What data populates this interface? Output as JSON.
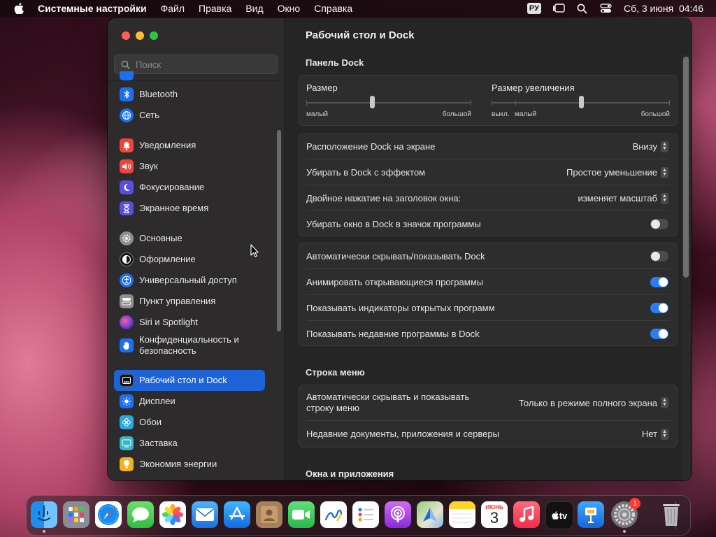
{
  "menubar": {
    "app_name": "Системные настройки",
    "items": [
      "Файл",
      "Правка",
      "Вид",
      "Окно",
      "Справка"
    ],
    "input_source": "РУ",
    "datetime": "Сб, 3 июня  04:46"
  },
  "sidebar": {
    "search_placeholder": "Поиск",
    "items": [
      {
        "label": "Bluetooth",
        "icon": "bluetooth-icon",
        "color": "#1d6ff2"
      },
      {
        "label": "Сеть",
        "icon": "globe-icon",
        "color": "#1d6ff2"
      },
      {
        "label": "Уведомления",
        "icon": "bell-icon",
        "color": "#f0443a"
      },
      {
        "label": "Звук",
        "icon": "speaker-icon",
        "color": "#f0443a"
      },
      {
        "label": "Фокусирование",
        "icon": "moon-icon",
        "color": "#5a4ee0"
      },
      {
        "label": "Экранное время",
        "icon": "hourglass-icon",
        "color": "#5a4ee0"
      },
      {
        "label": "Основные",
        "icon": "gear-icon",
        "color": "#8e8e93"
      },
      {
        "label": "Оформление",
        "icon": "appearance-icon",
        "color": "#1a1a1a"
      },
      {
        "label": "Универсальный доступ",
        "icon": "accessibility-icon",
        "color": "#1d6ff2"
      },
      {
        "label": "Пункт управления",
        "icon": "control-center-icon",
        "color": "#8e8e93"
      },
      {
        "label": "Siri и Spotlight",
        "icon": "siri-icon",
        "color": "#6b3fd6"
      },
      {
        "label": "Конфиденциальность и безопасность",
        "icon": "hand-icon",
        "color": "#1d6ff2"
      },
      {
        "label": "Рабочий стол и Dock",
        "icon": "dock-icon",
        "color": "#1a1a1a"
      },
      {
        "label": "Дисплеи",
        "icon": "sun-icon",
        "color": "#1d6ff2"
      },
      {
        "label": "Обои",
        "icon": "flower-icon",
        "color": "#2aa8e0"
      },
      {
        "label": "Заставка",
        "icon": "screensaver-icon",
        "color": "#35b7c9"
      },
      {
        "label": "Экономия энергии",
        "icon": "bulb-icon",
        "color": "#f2b11f"
      }
    ]
  },
  "main": {
    "title": "Рабочий стол и Dock",
    "dock_section": "Панель Dock",
    "size_slider": {
      "label": "Размер",
      "min": "малый",
      "max": "большой",
      "value": 0.4
    },
    "magnification_slider": {
      "label": "Размер увеличения",
      "off": "выкл.",
      "min": "малый",
      "max": "большой",
      "value": 0.5
    },
    "rows1": [
      {
        "label": "Расположение Dock на экране",
        "value": "Внизу"
      },
      {
        "label": "Убирать в Dock с эффектом",
        "value": "Простое уменьшение"
      },
      {
        "label": "Двойное нажатие на заголовок окна:",
        "value": "изменяет масштаб"
      },
      {
        "label": "Убирать окно в Dock в значок программы",
        "toggle": false
      }
    ],
    "rows2": [
      {
        "label": "Автоматически скрывать/показывать Dock",
        "toggle": false
      },
      {
        "label": "Анимировать открывающиеся программы",
        "toggle": true
      },
      {
        "label": "Показывать индикаторы открытых программ",
        "toggle": true
      },
      {
        "label": "Показывать недавние программы в Dock",
        "toggle": true
      }
    ],
    "menubar_section": "Строка меню",
    "menubar_rows": [
      {
        "label": "Автоматически скрывать и показывать строку меню",
        "value": "Только в режиме полного экрана"
      },
      {
        "label": "Недавние документы, приложения и серверы",
        "value": "Нет"
      }
    ],
    "windows_section": "Окна и приложения"
  },
  "dock": {
    "calendar_month": "ИЮНЬ",
    "calendar_day": "3",
    "tv_label": "tv",
    "settings_badge": "1"
  }
}
